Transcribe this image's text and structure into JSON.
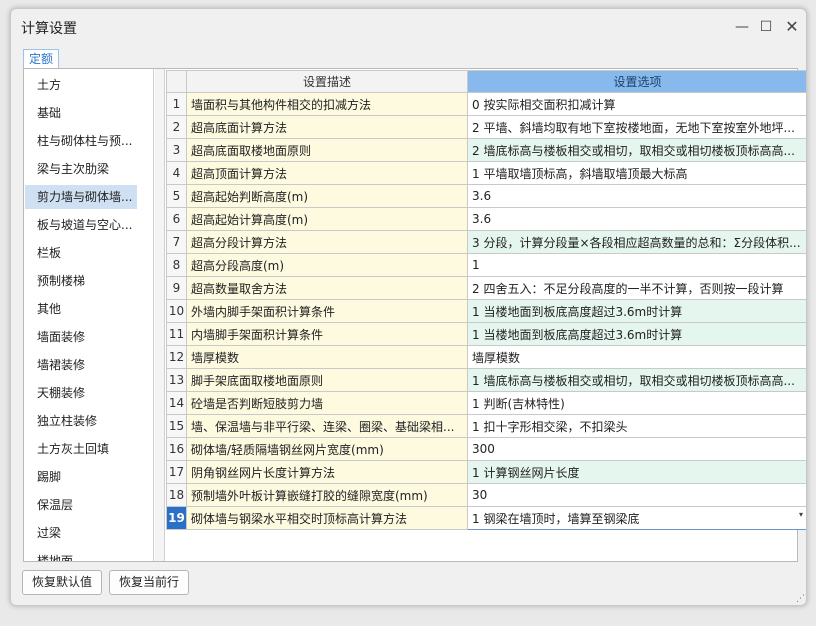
{
  "window": {
    "title": "计算设置",
    "minimize_glyph": "—",
    "maximize_glyph": "☐",
    "close_glyph": "✕"
  },
  "tab": {
    "label": "定额"
  },
  "sidebar": {
    "items": [
      {
        "label": "土方"
      },
      {
        "label": "基础"
      },
      {
        "label": "柱与砌体柱与预..."
      },
      {
        "label": "梁与主次肋梁"
      },
      {
        "label": "剪力墙与砌体墙..."
      },
      {
        "label": "板与坡道与空心..."
      },
      {
        "label": "栏板"
      },
      {
        "label": "预制楼梯"
      },
      {
        "label": "其他"
      },
      {
        "label": "墙面装修"
      },
      {
        "label": "墙裙装修"
      },
      {
        "label": "天棚装修"
      },
      {
        "label": "独立柱装修"
      },
      {
        "label": "土方灰土回填"
      },
      {
        "label": "踢脚"
      },
      {
        "label": "保温层"
      },
      {
        "label": "过梁"
      },
      {
        "label": "楼地面"
      }
    ],
    "selected_index": 4
  },
  "grid": {
    "headers": {
      "index": "",
      "description": "设置描述",
      "option": "设置选项"
    },
    "rows": [
      {
        "n": "1",
        "desc": "墙面积与其他构件相交的扣减方法",
        "opt": "0 按实际相交面积扣减计算",
        "tint": false
      },
      {
        "n": "2",
        "desc": "超高底面计算方法",
        "opt": "2 平墙、斜墙均取有地下室按楼地面，无地下室按室外地坪...",
        "tint": false
      },
      {
        "n": "3",
        "desc": "超高底面取楼地面原则",
        "opt": "2 墙底标高与楼板相交或相切，取相交或相切楼板顶标高高...",
        "tint": true
      },
      {
        "n": "4",
        "desc": "超高顶面计算方法",
        "opt": "1 平墙取墙顶标高，斜墙取墙顶最大标高",
        "tint": false
      },
      {
        "n": "5",
        "desc": "超高起始判断高度(m)",
        "opt": "3.6",
        "tint": false
      },
      {
        "n": "6",
        "desc": "超高起始计算高度(m)",
        "opt": "3.6",
        "tint": false
      },
      {
        "n": "7",
        "desc": "超高分段计算方法",
        "opt": "3 分段，计算分段量×各段相应超高数量的总和：Σ分段体积...",
        "tint": true
      },
      {
        "n": "8",
        "desc": "超高分段高度(m)",
        "opt": "1",
        "tint": false
      },
      {
        "n": "9",
        "desc": "超高数量取舍方法",
        "opt": "2 四舍五入：不足分段高度的一半不计算，否则按一段计算",
        "tint": false
      },
      {
        "n": "10",
        "desc": "外墙内脚手架面积计算条件",
        "opt": "1 当楼地面到板底高度超过3.6m时计算",
        "tint": true
      },
      {
        "n": "11",
        "desc": "内墙脚手架面积计算条件",
        "opt": "1 当楼地面到板底高度超过3.6m时计算",
        "tint": true
      },
      {
        "n": "12",
        "desc": "墙厚模数",
        "opt": "墙厚模数",
        "tint": false
      },
      {
        "n": "13",
        "desc": "脚手架底面取楼地面原则",
        "opt": "1 墙底标高与楼板相交或相切，取相交或相切楼板顶标高高...",
        "tint": true
      },
      {
        "n": "14",
        "desc": "砼墙是否判断短肢剪力墙",
        "opt": "1 判断(吉林特性)",
        "tint": false
      },
      {
        "n": "15",
        "desc": "墙、保温墙与非平行梁、连梁、圈梁、基础梁相...",
        "opt": "1 扣十字形相交梁，不扣梁头",
        "tint": false
      },
      {
        "n": "16",
        "desc": "砌体墙/轻质隔墙钢丝网片宽度(mm)",
        "opt": "300",
        "tint": false
      },
      {
        "n": "17",
        "desc": "阴角钢丝网片长度计算方法",
        "opt": "1 计算钢丝网片长度",
        "tint": true
      },
      {
        "n": "18",
        "desc": "预制墙外叶板计算嵌缝打胶的缝隙宽度(mm)",
        "opt": "30",
        "tint": false
      },
      {
        "n": "19",
        "desc": "砌体墙与钢梁水平相交时顶标高计算方法",
        "opt": "1 钢梁在墙顶时，墙算至钢梁底",
        "tint": false
      }
    ],
    "current_row_index": 18,
    "dropdown_glyph": "▾"
  },
  "buttons": {
    "restore_default": "恢复默认值",
    "restore_current_row": "恢复当前行"
  },
  "colors": {
    "accent": "#2a6fc8",
    "option_header": "#87b9ec",
    "description_bg": "#fdfae0",
    "option_tint": "#e5f6ee",
    "sidebar_selected": "#cfe0f2"
  }
}
